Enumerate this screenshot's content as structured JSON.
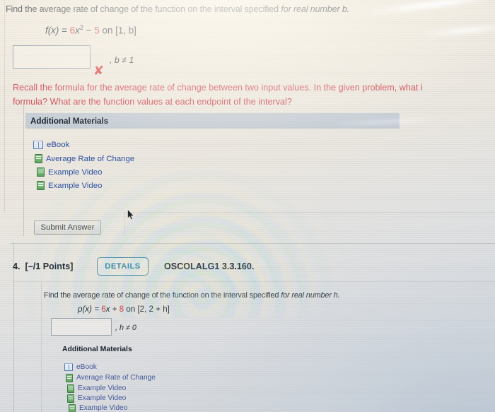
{
  "question_top": {
    "prompt_plain": "Find the average rate of change of the function on the interval specified ",
    "prompt_italic": "for real number b.",
    "formula": {
      "fn": "f(x) = ",
      "coef": "6",
      "x_sq": "x",
      "exp": "2",
      "minus": " − ",
      "const": "5",
      "interval": " on  [1, b]"
    },
    "answer_value": "",
    "answer_placeholder": "",
    "condition": ", b ≠ 1",
    "mark": "✘",
    "feedback_line1": "Recall the formula for the average rate of change between two input values. In the given problem, what i",
    "feedback_line2": "formula? What are the function values at each endpoint of the interval?",
    "additional_materials_title": "Additional Materials",
    "materials": [
      {
        "icon": "book-icon",
        "label": "eBook"
      },
      {
        "icon": "video-icon",
        "label": "Average Rate of Change"
      },
      {
        "icon": "video-icon",
        "label": "Example Video"
      },
      {
        "icon": "video-icon",
        "label": "Example Video"
      }
    ],
    "submit_label": "Submit Answer"
  },
  "question_4": {
    "number": "4.",
    "points": "[–/1 Points]",
    "details_label": "DETAILS",
    "code": "OSCOLALG1 3.3.160.",
    "prompt_plain": "Find the average rate of change of the function on the interval specified ",
    "prompt_italic": "for real number h.",
    "formula": {
      "fn": "p(x) = ",
      "coef": "6",
      "x_term": "x + ",
      "const": "8",
      "interval": "  on  [2, 2 + h]"
    },
    "answer_value": "",
    "condition": ", h ≠ 0",
    "additional_materials_title": "Additional Materials",
    "materials": [
      {
        "icon": "book-icon",
        "label": "eBook"
      },
      {
        "icon": "video-icon",
        "label": "Average Rate of Change"
      },
      {
        "icon": "video-icon",
        "label": "Example Video"
      },
      {
        "icon": "video-icon",
        "label": "Example Video"
      },
      {
        "icon": "video-icon",
        "label": "Example Video"
      }
    ]
  },
  "colors": {
    "text": "#1d2633",
    "accent_red": "#d2303c",
    "feedback_red": "#cf4450",
    "link_blue": "#2a4fa0",
    "details_blue": "#3f87ad",
    "materials_bar": "#c3ccd6"
  }
}
